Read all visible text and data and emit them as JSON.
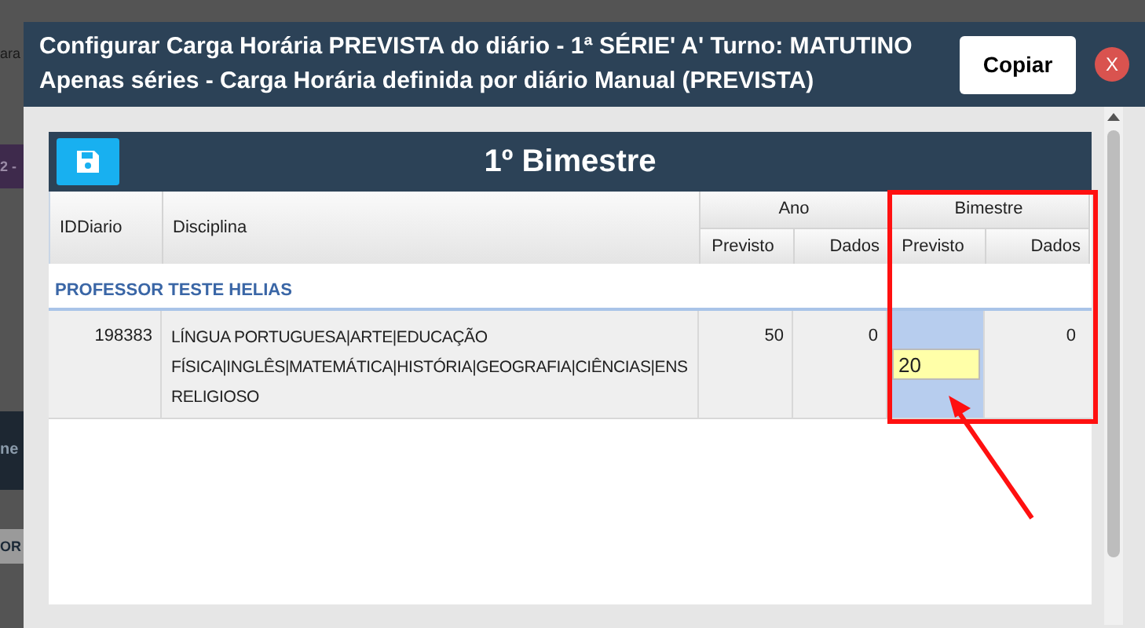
{
  "background_fragments": [
    "ara",
    "2 -",
    "ne",
    "OR"
  ],
  "dialog": {
    "title_lines": [
      "Configurar Carga Horária PREVISTA do diário - 1ª SÉRIE' A' Turno: MATUTINO",
      "Apenas séries - Carga Horária definida por diário Manual (PREVISTA)"
    ],
    "copy_button": "Copiar",
    "close_button": "X"
  },
  "panel": {
    "title": "1º Bimestre",
    "columns": {
      "id": "IDDiario",
      "discipline": "Disciplina",
      "year": "Ano",
      "term": "Bimestre",
      "year_sub": [
        "Previsto",
        "Dados"
      ],
      "term_sub": [
        "Previsto",
        "Dados"
      ]
    },
    "groups": [
      {
        "teacher": "PROFESSOR TESTE HELIAS",
        "rows": [
          {
            "id": "198383",
            "discipline_lines": [
              "LÍNGUA PORTUGUESA|ARTE|EDUCAÇÃO",
              "FÍSICA|INGLÊS|MATEMÁTICA|HISTÓRIA|GEOGRAFIA|CIÊNCIAS|ENS",
              "RELIGIOSO"
            ],
            "year_planned": "50",
            "year_data": "0",
            "term_planned": "20",
            "term_data": "0",
            "selected": true
          }
        ]
      }
    ]
  }
}
